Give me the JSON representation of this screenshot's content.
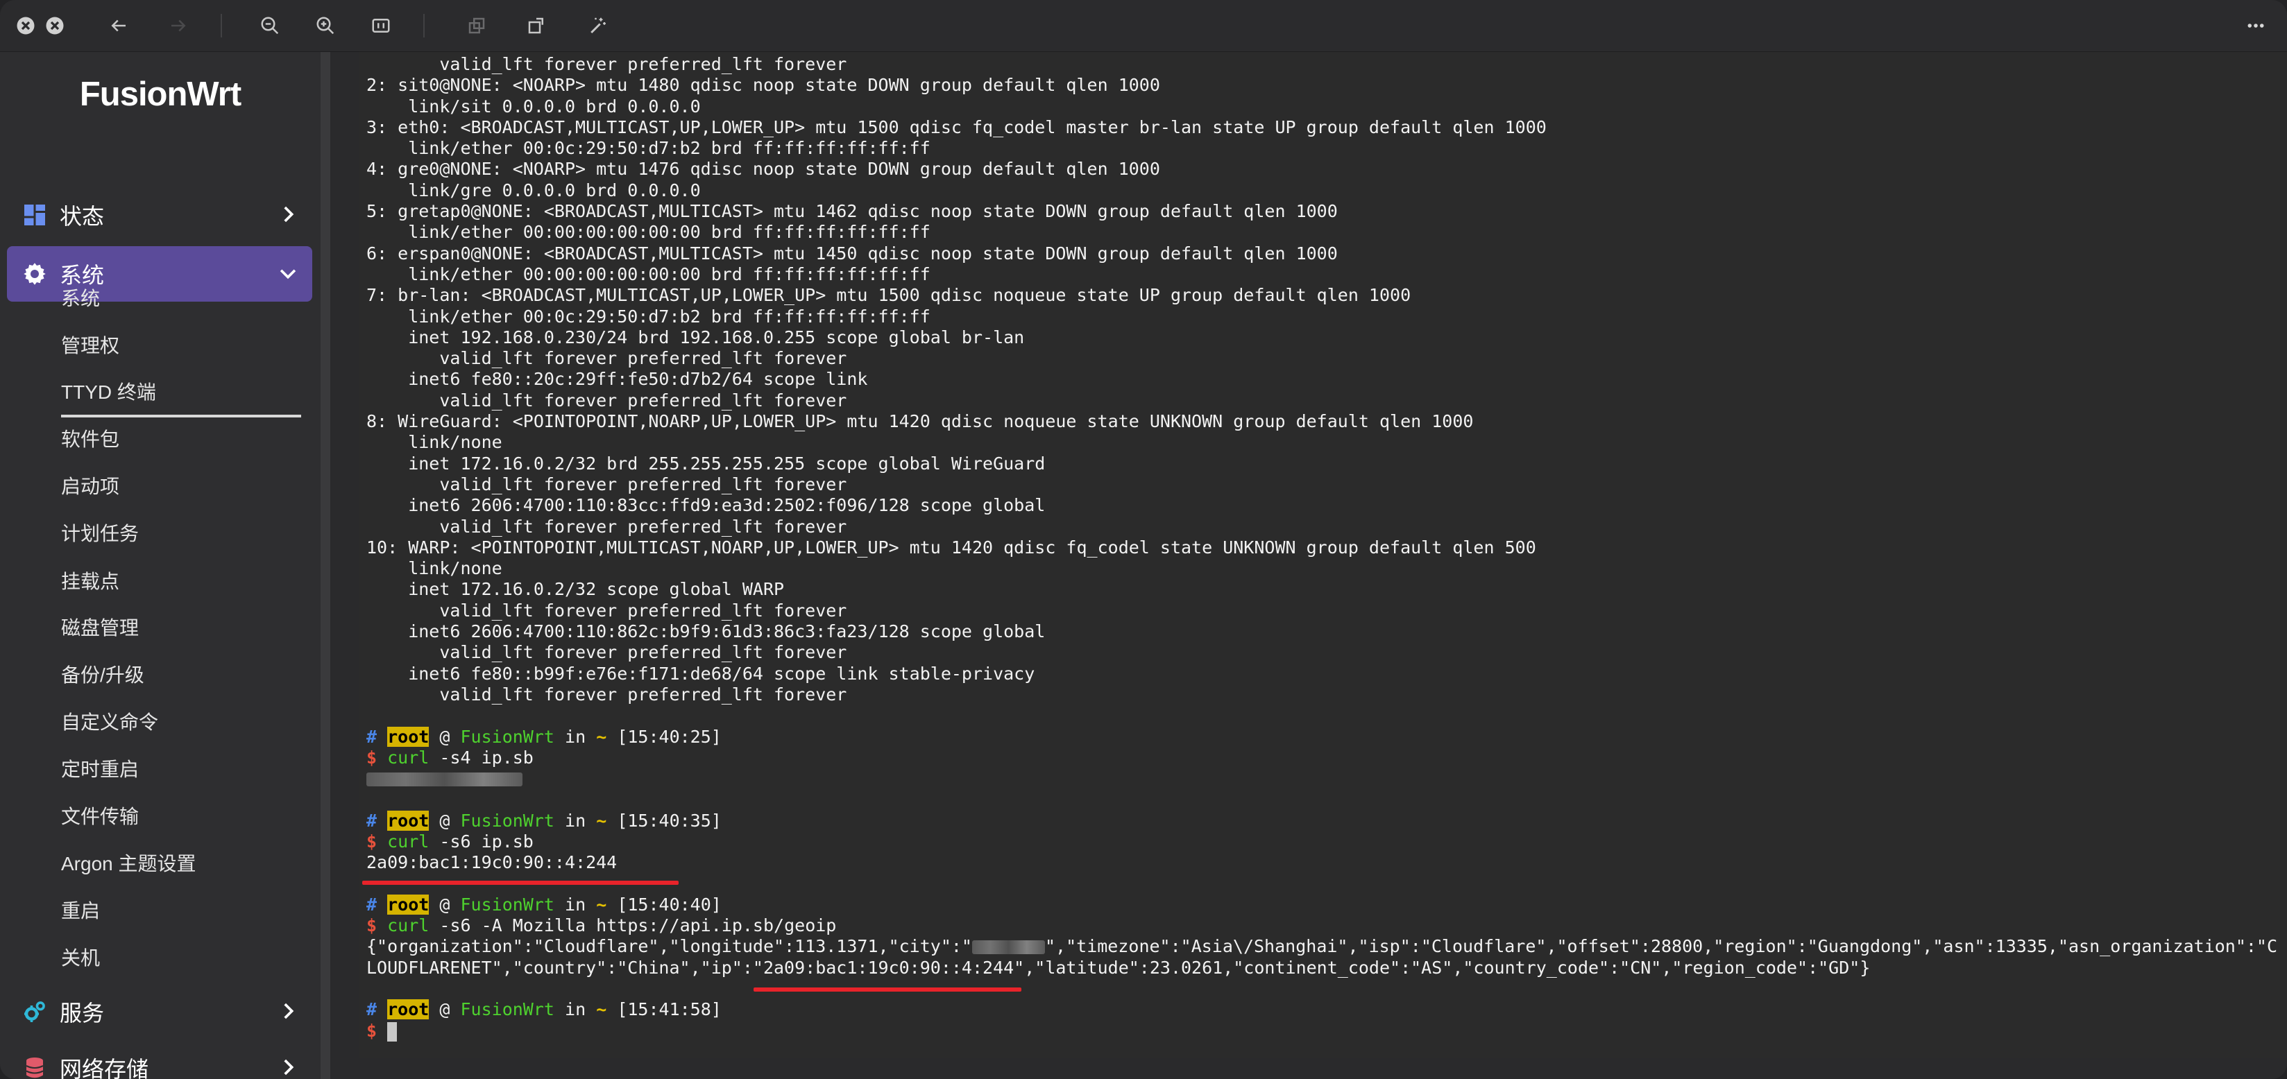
{
  "sidebar": {
    "logo": "FusionWrt",
    "groups": [
      {
        "label": "状态",
        "icon": "dashboard-icon"
      },
      {
        "label": "系统",
        "icon": "gear-icon"
      },
      {
        "label": "服务",
        "icon": "services-icon"
      },
      {
        "label": "网络存储",
        "icon": "storage-icon"
      }
    ],
    "system_items": [
      "系统",
      "管理权",
      "TTYD 终端",
      "软件包",
      "启动项",
      "计划任务",
      "挂载点",
      "磁盘管理",
      "备份/升级",
      "自定义命令",
      "定时重启",
      "文件传输",
      "Argon 主题设置",
      "重启",
      "关机"
    ],
    "active_item": "TTYD 终端"
  },
  "toolbar": {
    "icons": [
      "close-icon",
      "minimize-icon",
      "back-icon",
      "forward-icon",
      "zoom-out-icon",
      "zoom-in-icon",
      "fit-icon",
      "copy-icon",
      "rotate-icon",
      "magic-icon",
      "more-icon"
    ]
  },
  "colors": {
    "accent": "#5b4b9a",
    "terminal_bg": "#2b2b2b",
    "prompt_root_bg": "#d6b400",
    "prompt_green": "#4ed12e",
    "prompt_dollar": "#e8523c",
    "annotation_red": "#e8232a"
  },
  "terminal": {
    "output_lines": [
      "       valid_lft forever preferred_lft forever",
      "2: sit0@NONE: <NOARP> mtu 1480 qdisc noop state DOWN group default qlen 1000",
      "    link/sit 0.0.0.0 brd 0.0.0.0",
      "3: eth0: <BROADCAST,MULTICAST,UP,LOWER_UP> mtu 1500 qdisc fq_codel master br-lan state UP group default qlen 1000",
      "    link/ether 00:0c:29:50:d7:b2 brd ff:ff:ff:ff:ff:ff",
      "4: gre0@NONE: <NOARP> mtu 1476 qdisc noop state DOWN group default qlen 1000",
      "    link/gre 0.0.0.0 brd 0.0.0.0",
      "5: gretap0@NONE: <BROADCAST,MULTICAST> mtu 1462 qdisc noop state DOWN group default qlen 1000",
      "    link/ether 00:00:00:00:00:00 brd ff:ff:ff:ff:ff:ff",
      "6: erspan0@NONE: <BROADCAST,MULTICAST> mtu 1450 qdisc noop state DOWN group default qlen 1000",
      "    link/ether 00:00:00:00:00:00 brd ff:ff:ff:ff:ff:ff",
      "7: br-lan: <BROADCAST,MULTICAST,UP,LOWER_UP> mtu 1500 qdisc noqueue state UP group default qlen 1000",
      "    link/ether 00:0c:29:50:d7:b2 brd ff:ff:ff:ff:ff:ff",
      "    inet 192.168.0.230/24 brd 192.168.0.255 scope global br-lan",
      "       valid_lft forever preferred_lft forever",
      "    inet6 fe80::20c:29ff:fe50:d7b2/64 scope link",
      "       valid_lft forever preferred_lft forever",
      "8: WireGuard: <POINTOPOINT,NOARP,UP,LOWER_UP> mtu 1420 qdisc noqueue state UNKNOWN group default qlen 1000",
      "    link/none",
      "    inet 172.16.0.2/32 brd 255.255.255.255 scope global WireGuard",
      "       valid_lft forever preferred_lft forever",
      "    inet6 2606:4700:110:83cc:ffd9:ea3d:2502:f096/128 scope global",
      "       valid_lft forever preferred_lft forever",
      "10: WARP: <POINTOPOINT,MULTICAST,NOARP,UP,LOWER_UP> mtu 1420 qdisc fq_codel state UNKNOWN group default qlen 500",
      "    link/none",
      "    inet 172.16.0.2/32 scope global WARP",
      "       valid_lft forever preferred_lft forever",
      "    inet6 2606:4700:110:862c:b9f9:61d3:86c3:fa23/128 scope global",
      "       valid_lft forever preferred_lft forever",
      "    inet6 fe80::b99f:e76e:f171:de68/64 scope link stable-privacy",
      "       valid_lft forever preferred_lft forever"
    ],
    "prompt": {
      "user": "root",
      "host": "FusionWrt",
      "in_word": "in",
      "dir": "~"
    },
    "sessions": [
      {
        "time": "[15:40:25]",
        "cmd": "curl",
        "args": " -s4 ip.sb"
      },
      {
        "time": "[15:40:35]",
        "cmd": "curl",
        "args": " -s6 ip.sb",
        "output": "2a09:bac1:19c0:90::4:244"
      },
      {
        "time": "[15:40:40]",
        "cmd": "curl",
        "args": " -s6 -A Mozilla https://api.ip.sb/geoip"
      },
      {
        "time": "[15:41:58]"
      }
    ],
    "geoip_part1": "{\"organization\":\"Cloudflare\",\"longitude\":113.1371,\"city\":\"",
    "geoip_part2": "\",\"timezone\":\"Asia\\/Shanghai\",\"isp\":\"Cloudflare\",\"offset\":28800,\"region\":\"Guangdong\",\"asn\":13335,\"asn_organization\":\"C",
    "geoip_line2": "LOUDFLARENET\",\"country\":\"China\",\"ip\":\"2a09:bac1:19c0:90::4:244\",\"latitude\":23.0261,\"continent_code\":\"AS\",\"country_code\":\"CN\",\"region_code\":\"GD\"}"
  }
}
